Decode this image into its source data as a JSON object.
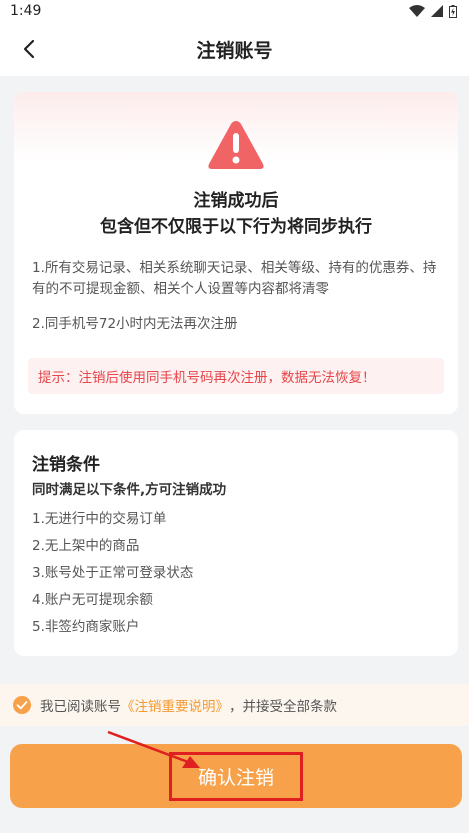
{
  "status_bar": {
    "time": "1:49"
  },
  "header": {
    "title": "注销账号"
  },
  "card_consequences": {
    "title_line1": "注销成功后",
    "title_line2": "包含但不仅限于以下行为将同步执行",
    "item1": "1.所有交易记录、相关系统聊天记录、相关等级、持有的优惠券、持有的不可提现金额、相关个人设置等内容都将清零",
    "item2": "2.同手机号72小时内无法再次注册",
    "tip": "提示：注销后使用同手机号码再次注册，数据无法恢复！"
  },
  "card_conditions": {
    "title": "注销条件",
    "subtitle": "同时满足以下条件,方可注销成功",
    "items": [
      "1.无进行中的交易订单",
      "2.无上架中的商品",
      "3.账号处于正常可登录状态",
      "4.账户无可提现余额",
      "5.非签约商家账户"
    ]
  },
  "agreement": {
    "prefix": "我已阅读账号",
    "link": "《注销重要说明》",
    "suffix": "，并接受全部条款",
    "checked": true
  },
  "confirm_button": {
    "label": "确认注销"
  },
  "colors": {
    "accent": "#f7a24a",
    "warning_red": "#e8454a",
    "link_orange": "#f39a34"
  }
}
